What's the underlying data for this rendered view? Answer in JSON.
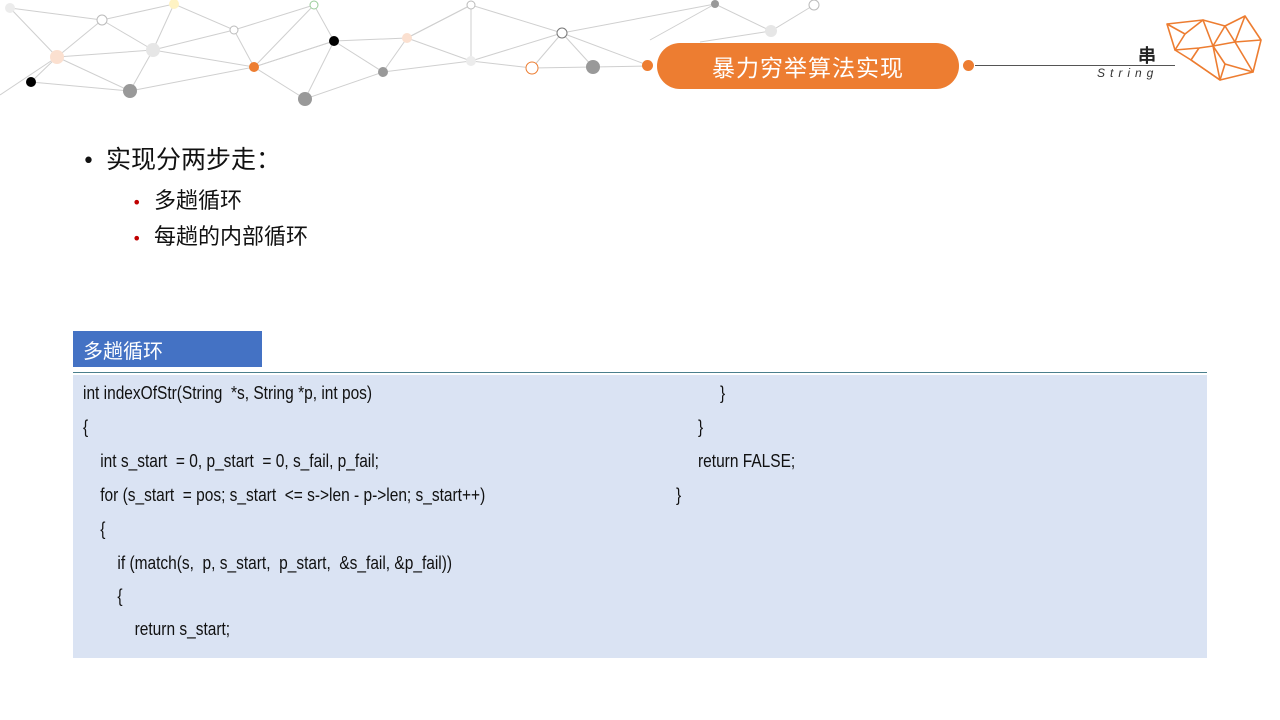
{
  "header": {
    "title": "暴力穷举算法实现",
    "brand": "串",
    "brand_sub": "String",
    "accent_color": "#ED7D31"
  },
  "bullets": {
    "main": "实现分两步走：",
    "subs": [
      "多趟循环",
      "每趟的内部循环"
    ]
  },
  "code_block": {
    "tab_label": "多趟循环",
    "tab_color": "#4472C4",
    "background_color": "#DAE3F3",
    "left_lines": [
      "int indexOfStr(String  *s, String *p, int pos)",
      "{",
      "    int s_start  = 0, p_start  = 0, s_fail, p_fail;",
      "    for (s_start  = pos; s_start  <= s->len - p->len; s_start++)",
      "    {",
      "        if (match(s,  p, s_start,  p_start,  &s_fail, &p_fail))",
      "        {",
      "            return s_start;"
    ],
    "right_lines": [
      "}",
      "}",
      "return FALSE;",
      "}"
    ]
  }
}
